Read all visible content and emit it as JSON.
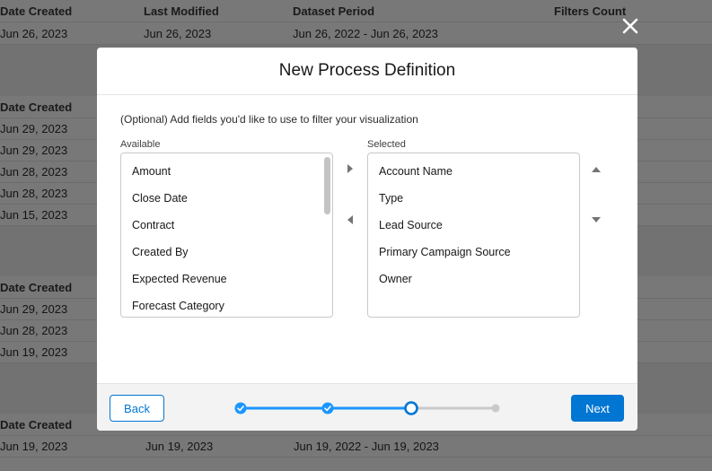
{
  "background": {
    "columns": [
      "Date Created",
      "Last Modified",
      "Dataset Period",
      "Filters Count"
    ],
    "first_row": [
      "Jun 26, 2023",
      "Jun 26, 2023",
      "Jun 26, 2022 - Jun 26, 2023"
    ],
    "group2": {
      "header": "Date Created",
      "rows": [
        "Jun 29, 2023",
        "Jun 29, 2023",
        "Jun 28, 2023",
        "Jun 28, 2023",
        "Jun 15, 2023"
      ]
    },
    "group3": {
      "header": "Date Created",
      "rows": [
        "Jun 29, 2023",
        "Jun 28, 2023",
        "Jun 19, 2023"
      ]
    },
    "group4": {
      "header": "Date Created",
      "row": [
        "Jun 19, 2023",
        "Jun 19, 2023",
        "Jun 19, 2022 - Jun 19, 2023"
      ]
    }
  },
  "modal": {
    "title": "New Process Definition",
    "instructions": "(Optional) Add fields you'd like to use to filter your visualization",
    "available_label": "Available",
    "selected_label": "Selected",
    "available": [
      "Amount",
      "Close Date",
      "Contract",
      "Created By",
      "Expected Revenue",
      "Forecast Category"
    ],
    "selected": [
      "Account Name",
      "Type",
      "Lead Source",
      "Primary Campaign Source",
      "Owner"
    ],
    "back_label": "Back",
    "next_label": "Next",
    "progress": {
      "total_steps": 4,
      "current_step": 3,
      "completed_steps": 2
    }
  },
  "colors": {
    "accent": "#0176d3",
    "progress_line": "#1b96ff",
    "overlay": "#787878"
  }
}
